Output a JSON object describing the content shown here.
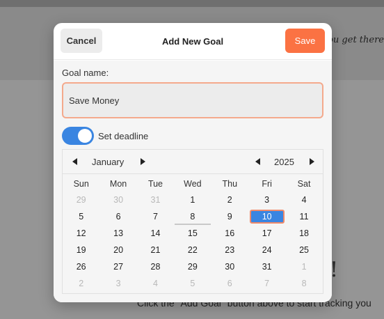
{
  "background": {
    "tagline": "you get there",
    "bang": "!",
    "hint": "Click the \"Add Goal\" button above to start tracking you"
  },
  "modal": {
    "title": "Add New Goal",
    "cancel_label": "Cancel",
    "save_label": "Save",
    "goal_label": "Goal name:",
    "goal_value": "Save Money",
    "deadline_label": "Set deadline",
    "deadline_enabled": true
  },
  "calendar": {
    "month": "January",
    "year": "2025",
    "weekdays": [
      "Sun",
      "Mon",
      "Tue",
      "Wed",
      "Thu",
      "Fri",
      "Sat"
    ],
    "selected_day": "10",
    "days": [
      {
        "d": "29",
        "m": true
      },
      {
        "d": "30",
        "m": true
      },
      {
        "d": "31",
        "m": true
      },
      {
        "d": "1"
      },
      {
        "d": "2"
      },
      {
        "d": "3"
      },
      {
        "d": "4"
      },
      {
        "d": "5"
      },
      {
        "d": "6"
      },
      {
        "d": "7"
      },
      {
        "d": "8",
        "today": true
      },
      {
        "d": "9"
      },
      {
        "d": "10",
        "sel": true
      },
      {
        "d": "11"
      },
      {
        "d": "12"
      },
      {
        "d": "13"
      },
      {
        "d": "14"
      },
      {
        "d": "15"
      },
      {
        "d": "16"
      },
      {
        "d": "17"
      },
      {
        "d": "18"
      },
      {
        "d": "19"
      },
      {
        "d": "20"
      },
      {
        "d": "21"
      },
      {
        "d": "22"
      },
      {
        "d": "23"
      },
      {
        "d": "24"
      },
      {
        "d": "25"
      },
      {
        "d": "26"
      },
      {
        "d": "27"
      },
      {
        "d": "28"
      },
      {
        "d": "29"
      },
      {
        "d": "30"
      },
      {
        "d": "31"
      },
      {
        "d": "1",
        "m": true
      },
      {
        "d": "2",
        "m": true
      },
      {
        "d": "3",
        "m": true
      },
      {
        "d": "4",
        "m": true
      },
      {
        "d": "5",
        "m": true
      },
      {
        "d": "6",
        "m": true
      },
      {
        "d": "7",
        "m": true
      },
      {
        "d": "8",
        "m": true
      }
    ]
  },
  "colors": {
    "accent_save": "#fb7243",
    "toggle_on": "#3a85e1",
    "input_border": "#f4a98c"
  }
}
